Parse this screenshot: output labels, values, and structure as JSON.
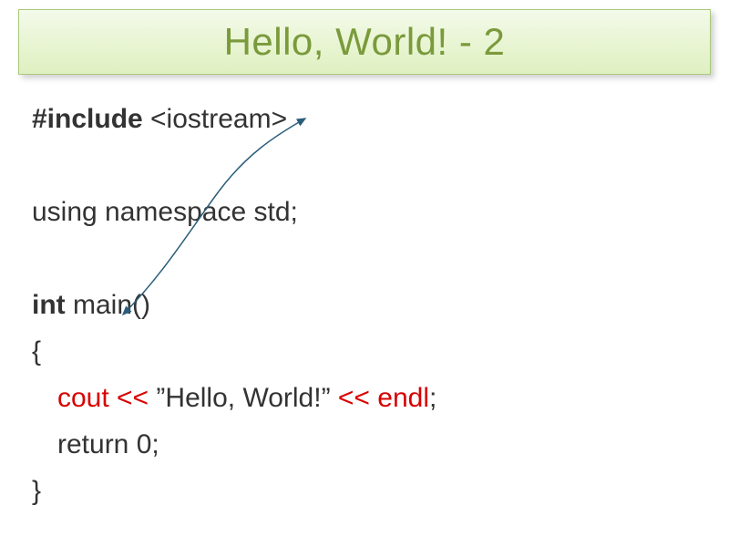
{
  "title": "Hello, World! - 2",
  "code": {
    "line1_include": "#include",
    "line1_header": " <iostream>",
    "line2": "using namespace std;",
    "line3_int": "int",
    "line3_main": " main()",
    "line4": "{",
    "line5_cout": "cout <<",
    "line5_str": " ”Hello, World!” ",
    "line5_endl": "<< endl",
    "line5_semi": ";",
    "line6": "return 0;",
    "line7": "}"
  }
}
